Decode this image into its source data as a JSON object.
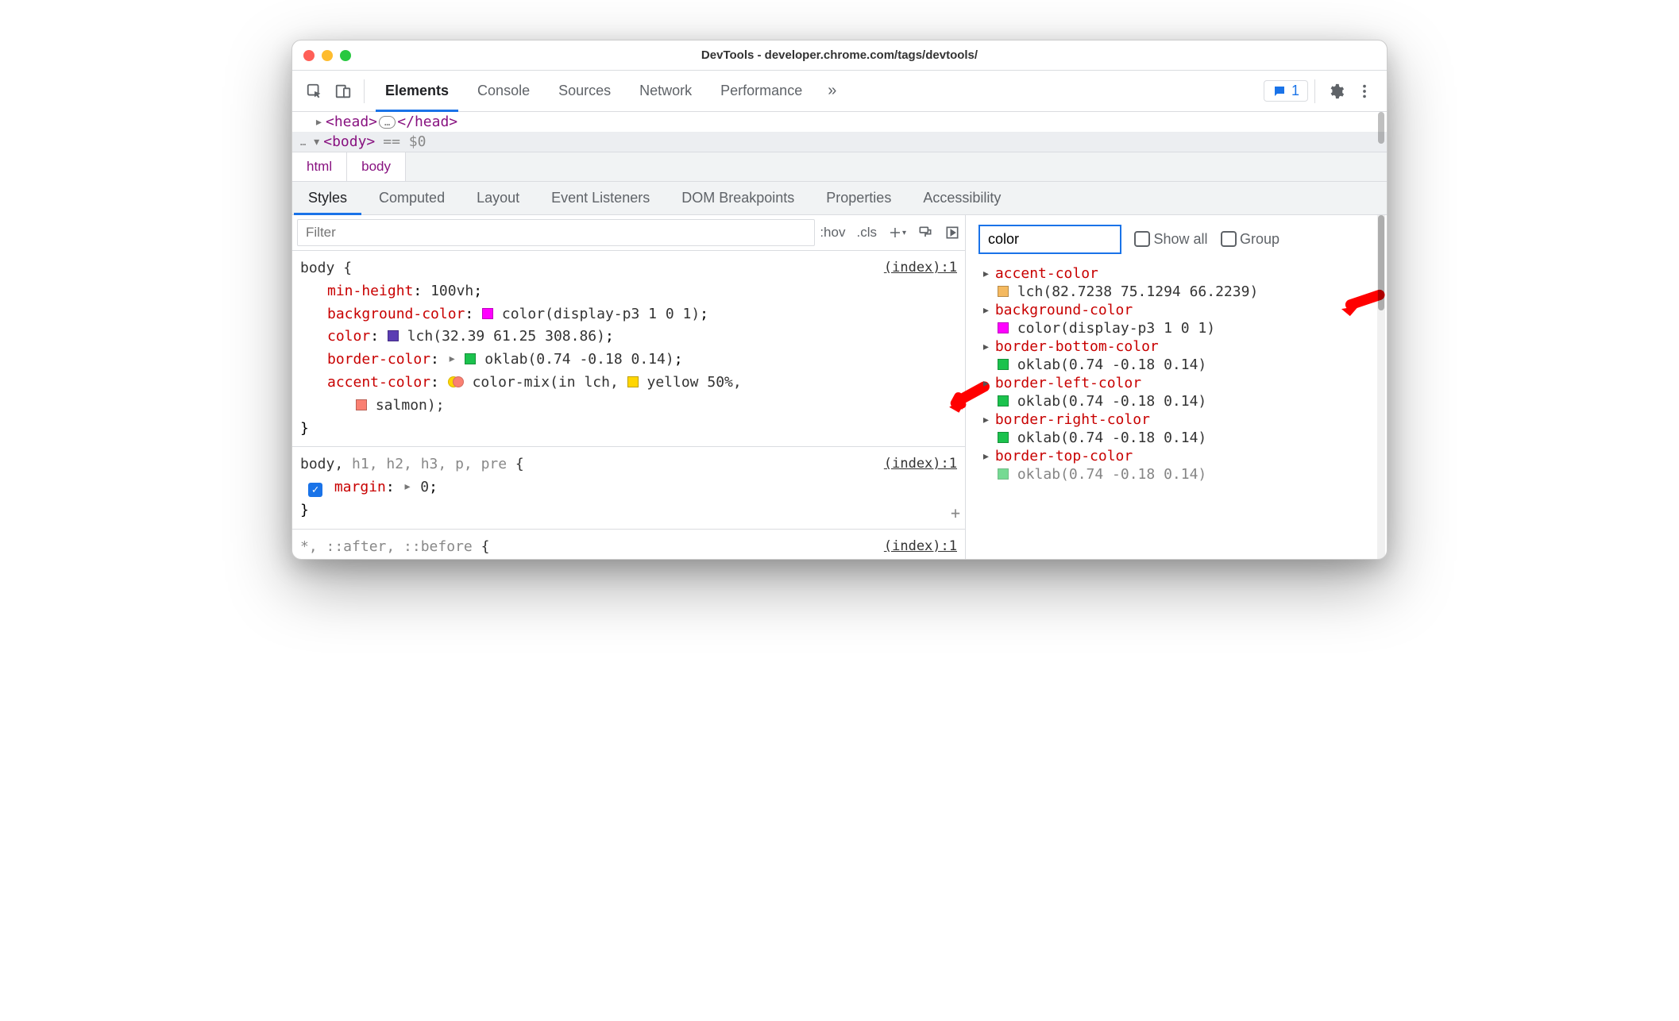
{
  "window_title": "DevTools - developer.chrome.com/tags/devtools/",
  "main_toolbar": {
    "tabs": [
      "Elements",
      "Console",
      "Sources",
      "Network",
      "Performance"
    ],
    "overflow": "»",
    "message_count": "1"
  },
  "dom": {
    "head_open": "<head>",
    "head_close": "</head>",
    "body_open": "<body>",
    "selected_marker": "== $0",
    "ellipsis": "…"
  },
  "breadcrumb": [
    "html",
    "body"
  ],
  "styles_tabs": [
    "Styles",
    "Computed",
    "Layout",
    "Event Listeners",
    "DOM Breakpoints",
    "Properties",
    "Accessibility"
  ],
  "styles_tabs_active": 0,
  "filter": {
    "placeholder": "Filter",
    "hov": ":hov",
    "cls": ".cls"
  },
  "rules": [
    {
      "selector_main": "body",
      "selector_dim": "",
      "source": "(index):1",
      "props": [
        {
          "name": "min-height",
          "value": "100vh",
          "swatch": null
        },
        {
          "name": "background-color",
          "value": "color(display-p3 1 0 1)",
          "swatch": "#ff00ff"
        },
        {
          "name": "color",
          "value": "lch(32.39 61.25 308.86)",
          "swatch": "#5b3db3"
        },
        {
          "name": "border-color",
          "pre_tri": true,
          "value": "oklab(0.74 -0.18 0.14)",
          "swatch": "#1bc24d"
        },
        {
          "name": "accent-color",
          "mix": true,
          "value_prefix": "color-mix(in lch, ",
          "swatch2": "#ffd600",
          "mid": "yellow 50%,",
          "cont_swatch": "#fa8072",
          "cont": "salmon);"
        }
      ]
    },
    {
      "selector_main": "body,",
      "selector_dim": " h1, h2, h3, p, pre",
      "source": "(index):1",
      "props_checked": [
        {
          "name": "margin",
          "value": "0",
          "tri": true
        }
      ]
    },
    {
      "selector_main": "",
      "selector_dim": "*, ::after, ::before",
      "source": "(index):1",
      "truncated": true
    }
  ],
  "computed": {
    "filter_value": "color",
    "show_all_label": "Show all",
    "group_label": "Group",
    "rows": [
      {
        "name": "accent-color",
        "swatch": "#f4b960",
        "value": "lch(82.7238 75.1294 66.2239)"
      },
      {
        "name": "background-color",
        "swatch": "#ff00ff",
        "value": "color(display-p3 1 0 1)"
      },
      {
        "name": "border-bottom-color",
        "swatch": "#1bc24d",
        "value": "oklab(0.74 -0.18 0.14)"
      },
      {
        "name": "border-left-color",
        "swatch": "#1bc24d",
        "value": "oklab(0.74 -0.18 0.14)"
      },
      {
        "name": "border-right-color",
        "swatch": "#1bc24d",
        "value": "oklab(0.74 -0.18 0.14)"
      },
      {
        "name": "border-top-color",
        "swatch": "#1bc24d",
        "value": "oklab(0.74 -0.18 0.14)"
      }
    ]
  }
}
